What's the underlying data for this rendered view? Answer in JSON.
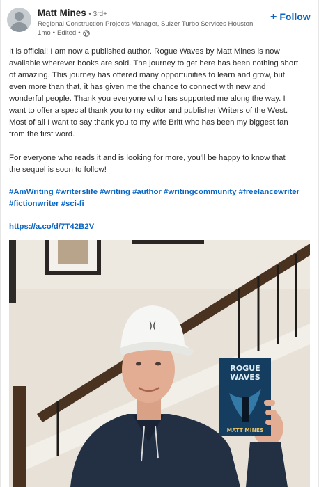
{
  "author": {
    "name": "Matt Mines",
    "degree": "• 3rd+",
    "headline": "Regional Construction Projects Manager, Sulzer Turbo Services Houston",
    "time": "1mo",
    "edited": "Edited",
    "visibility_icon": "globe-icon"
  },
  "follow": {
    "label": "Follow",
    "icon": "plus-icon"
  },
  "post": {
    "paragraph1": "It is official! I am now a published author. Rogue Waves by Matt Mines is now\navailable wherever books are sold. The journey to get here has been nothing short\nof amazing. This journey has offered many opportunities to learn and grow, but\neven more than that, it has given me the chance to connect with new and\nwonderful people. Thank you everyone who has supported me along the way. I\nwant to offer a special thank you to my editor and publisher Writers of the West.\nMost of all I want to say thank you to my wife Britt who has been my biggest fan\nfrom the first word.",
    "paragraph2": "For everyone who reads it and is looking for more, you'll be happy to know that\nthe sequel is soon to follow!",
    "hashtags": [
      "#AmWriting",
      "#writerslife",
      "#writing",
      "#author",
      "#writingcommunity",
      "#freelancewriter",
      "#fictionwriter",
      "#sci-fi"
    ],
    "link": "https://a.co/d/7T42B2V"
  },
  "photo": {
    "book_title_line1": "ROGUE",
    "book_title_line2": "WAVES",
    "book_author": "MATT MINES"
  },
  "colors": {
    "accent": "#0a66c2",
    "text": "#1f1f1f",
    "muted": "#5e5e5e"
  }
}
